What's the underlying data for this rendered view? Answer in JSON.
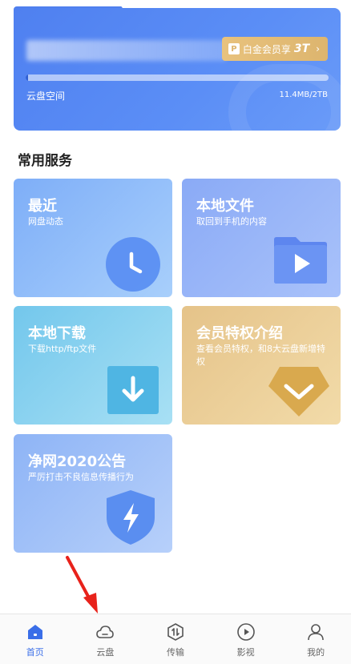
{
  "storage": {
    "vip_label": "白金会员享",
    "vip_capacity": "3T",
    "label": "云盘空间",
    "usage": "11.4MB/2TB",
    "usage_fraction": 0.006
  },
  "section_title": "常用服务",
  "services": {
    "recent": {
      "title": "最近",
      "subtitle": "网盘动态"
    },
    "local_files": {
      "title": "本地文件",
      "subtitle": "取回到手机的内容"
    },
    "local_download": {
      "title": "本地下载",
      "subtitle": "下载http/ftp文件"
    },
    "vip_privileges": {
      "title": "会员特权介绍",
      "subtitle": "查看会员特权，和8大云盘新增特权"
    },
    "notice": {
      "title": "净网2020公告",
      "subtitle": "严厉打击不良信息传播行为"
    }
  },
  "tabbar": {
    "home": "首页",
    "cloud": "云盘",
    "transfer": "传输",
    "video": "影视",
    "mine": "我的"
  },
  "colors": {
    "accent": "#3a6ee8",
    "annotation": "#e8221b"
  }
}
